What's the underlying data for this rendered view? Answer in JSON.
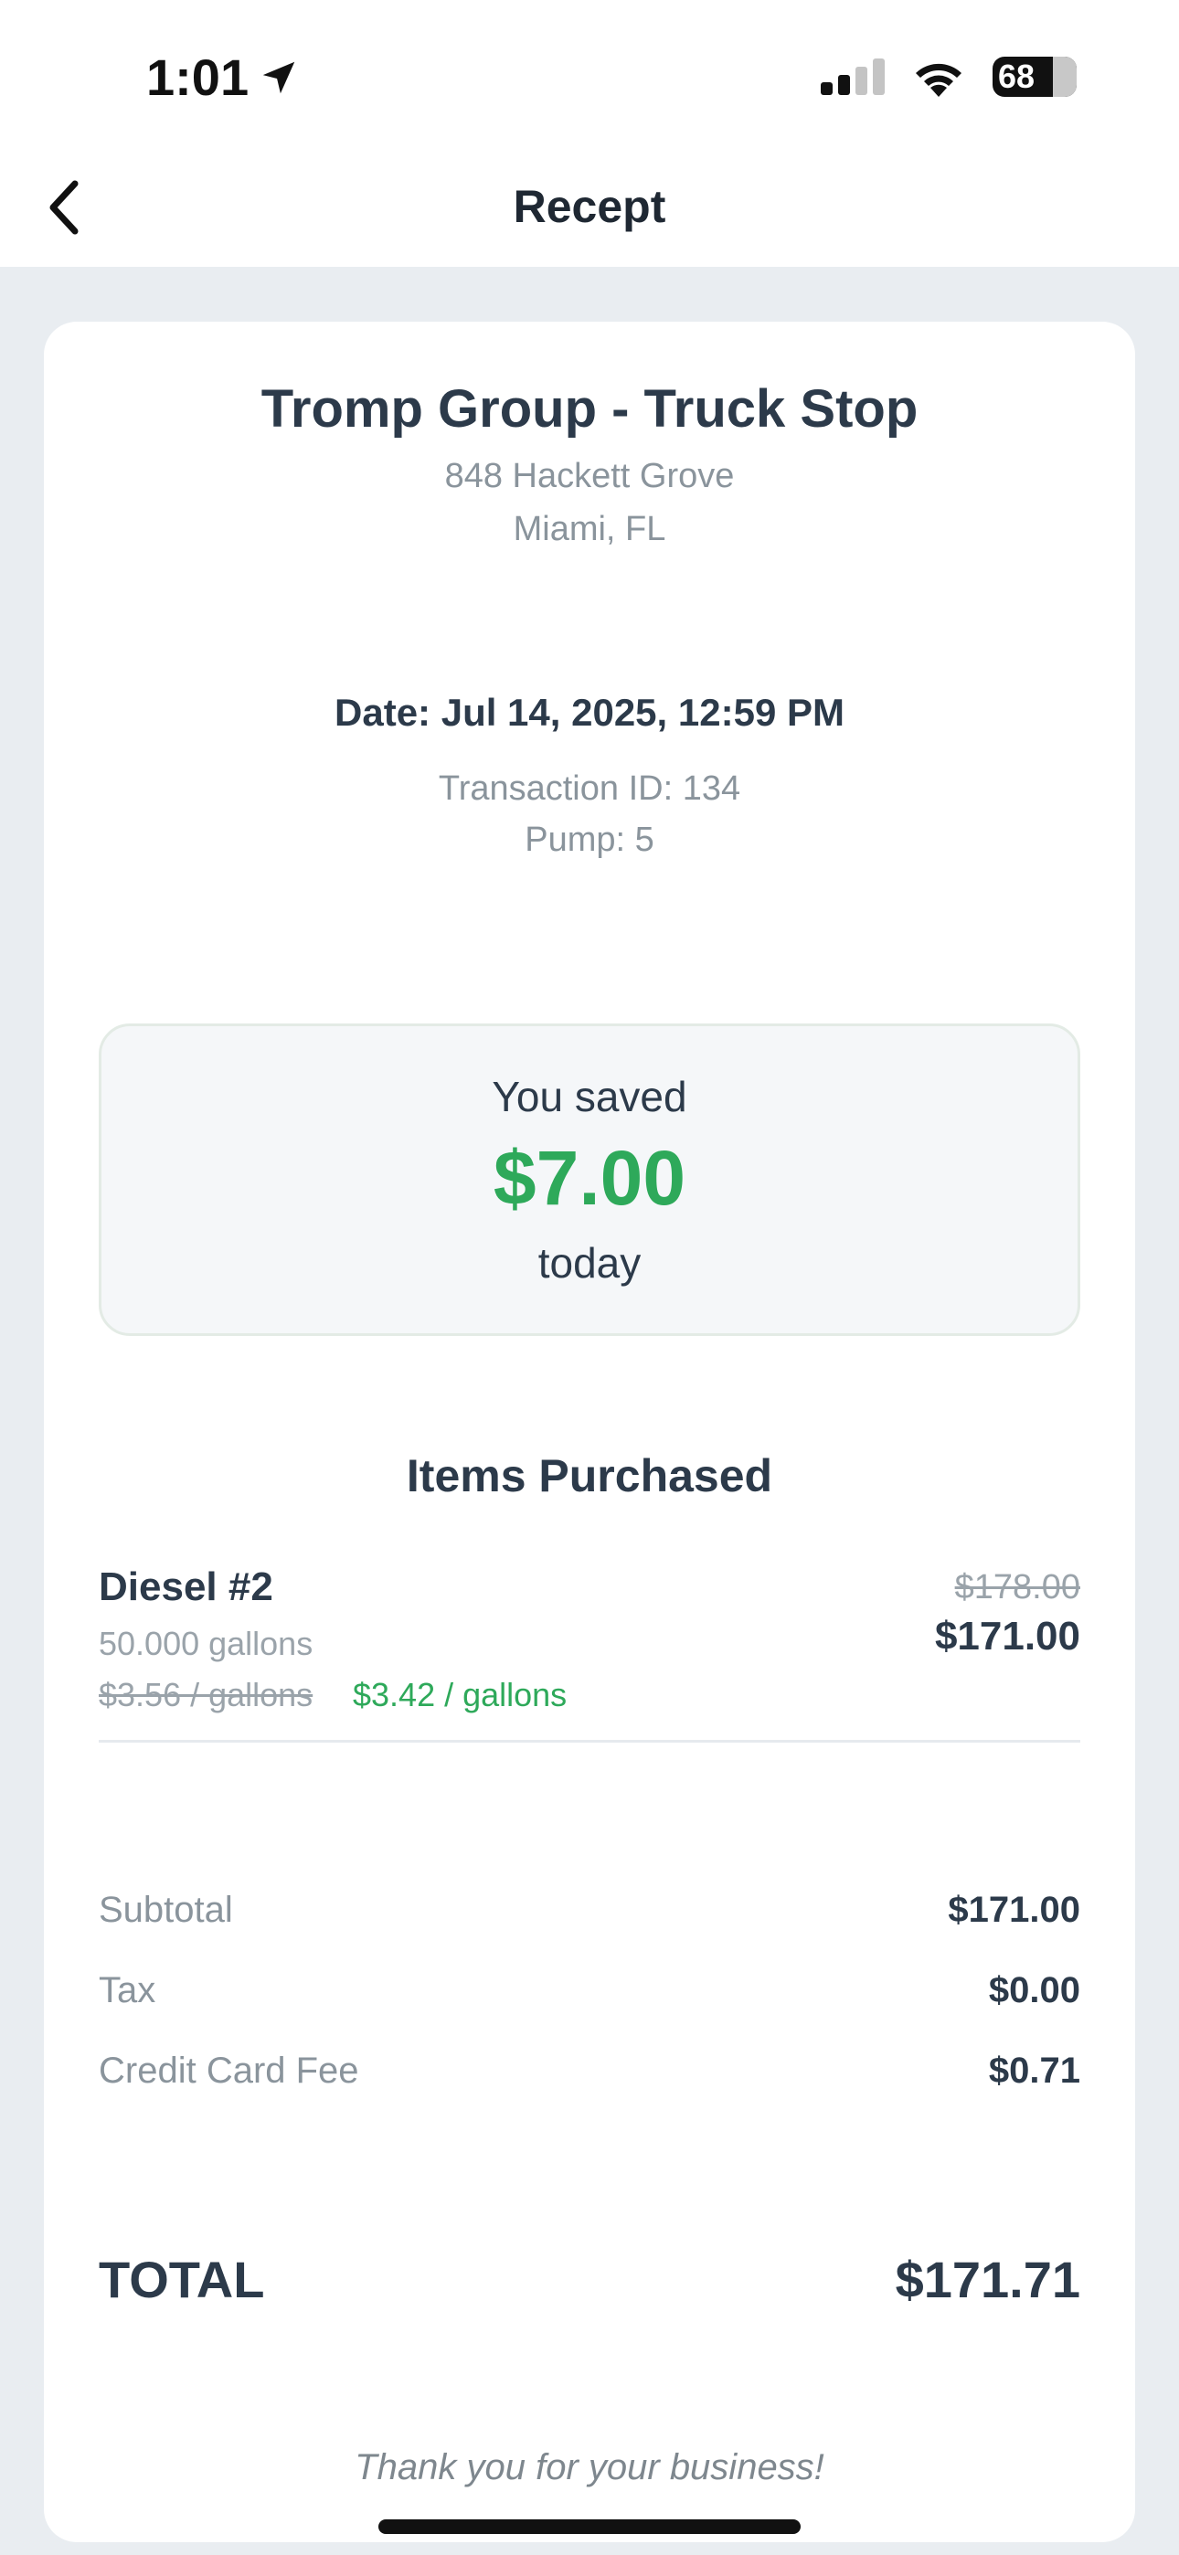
{
  "status_bar": {
    "time": "1:01",
    "battery": "68",
    "icons": [
      "location-arrow-icon",
      "signal-icon",
      "wifi-icon",
      "battery-icon"
    ]
  },
  "nav": {
    "title": "Recept",
    "back_icon": "chevron-left-icon"
  },
  "store": {
    "name": "Tromp Group - Truck Stop",
    "address_line1": "848 Hackett Grove",
    "address_line2": "Miami, FL"
  },
  "transaction": {
    "date": "Date: Jul 14, 2025, 12:59 PM",
    "id": "Transaction ID: 134",
    "pump": "Pump: 5"
  },
  "savings": {
    "label": "You saved",
    "amount": "$7.00",
    "suffix": "today"
  },
  "items": {
    "title": "Items Purchased",
    "list": [
      {
        "name": "Diesel #2",
        "quantity": "50.000 gallons",
        "old_unit_price": "$3.56 / gallons",
        "new_unit_price": "$3.42 / gallons",
        "old_total": "$178.00",
        "total": "$171.00"
      }
    ]
  },
  "summary": {
    "subtotal_label": "Subtotal",
    "subtotal": "$171.00",
    "tax_label": "Tax",
    "tax": "$0.00",
    "fee_label": "Credit Card Fee",
    "fee": "$0.71",
    "total_label": "TOTAL",
    "total": "$171.71"
  },
  "footer": {
    "thanks": "Thank you for your business!"
  },
  "colors": {
    "accent_green": "#2ea95a",
    "text_dark": "#2c3a4a",
    "text_muted": "#8a949c",
    "background": "#e9edf1"
  }
}
